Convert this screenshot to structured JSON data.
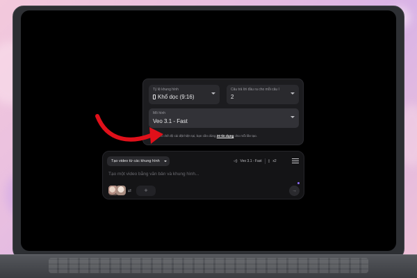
{
  "settings": {
    "aspect_ratio": {
      "label": "Tỷ lệ khung hình",
      "value": "Khổ dọc (9:16)",
      "icon": "portrait-phone-icon"
    },
    "outputs": {
      "label": "Câu trả lời đầu ra cho mỗi câu l",
      "value": "2"
    },
    "model": {
      "label": "Mô hình",
      "value": "Veo 3.1 - Fast"
    },
    "credit_note_prefix": "Dựa trên chế độ cài đặt hiện tại, bạn cần dùng ",
    "credit_note_amount": "20 tín dụng",
    "credit_note_suffix": " cho mỗi lần tạo."
  },
  "composer": {
    "mode_label": "Tạo video từ các khung hình",
    "model_label": "Veo 3.1 - Fast",
    "count_label": "x2",
    "placeholder": "Tạo một video bằng văn bản và khung hình...",
    "add_label": "+",
    "send_label": "→",
    "swap_label": "⇄"
  },
  "colors": {
    "arrow": "#e0101a",
    "accent_dot": "#8f6cff"
  }
}
